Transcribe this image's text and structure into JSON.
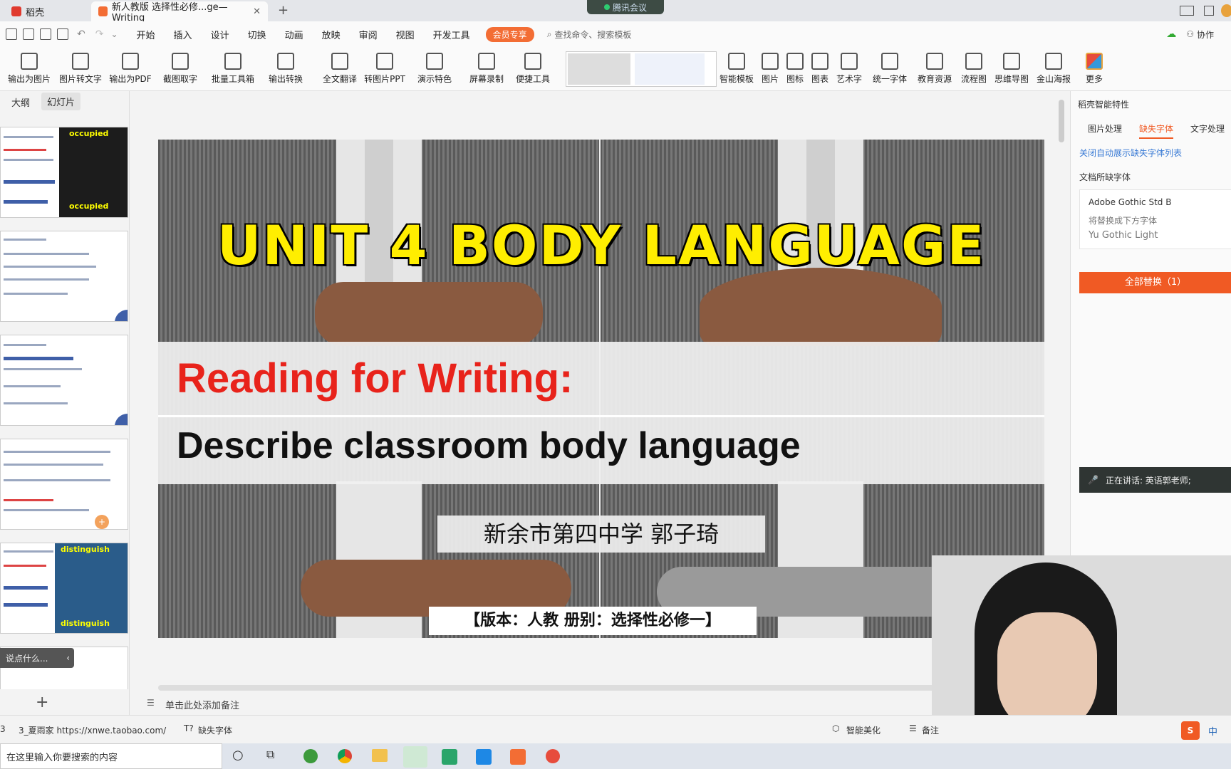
{
  "tabs": [
    {
      "label": "稻壳"
    },
    {
      "label": "新人教版 选择性必修...ge—Writing"
    }
  ],
  "meeting_badge": "腾讯会议",
  "menu": [
    "开始",
    "插入",
    "设计",
    "切换",
    "动画",
    "放映",
    "审阅",
    "视图",
    "开发工具"
  ],
  "vip_label": "会员专享",
  "search_placeholder": "查找命令、搜索模板",
  "collab_label": "协作",
  "ribbon": [
    "输出为图片",
    "图片转文字",
    "输出为PDF",
    "截图取字",
    "批量工具箱",
    "输出转换",
    "全文翻译",
    "转图片PPT",
    "演示特色",
    "屏幕录制",
    "便捷工具",
    "智能模板",
    "图片",
    "图标",
    "图表",
    "艺术字",
    "统一字体",
    "教育资源",
    "流程图",
    "思维导图",
    "金山海报",
    "更多"
  ],
  "left_tabs": {
    "outline": "大纲",
    "slides": "幻灯片"
  },
  "thumb_words": {
    "t1_top": "occupied",
    "t1_bottom": "occupied",
    "t5_top": "distinguish",
    "t5_bottom": "distinguish"
  },
  "chat_hint": "说点什么...",
  "slide": {
    "title": "UNIT 4 BODY LANGUAGE",
    "subtitle_red": "Reading for Writing:",
    "subtitle_black": "Describe classroom body language",
    "author": "新余市第四中学  郭子琦",
    "edition": "【版本：人教   册别：选择性必修一】"
  },
  "notes_placeholder": "单击此处添加备注",
  "right_panel": {
    "header": "稻壳智能特性",
    "tabs": [
      "图片处理",
      "缺失字体",
      "文字处理"
    ],
    "link": "关闭自动展示缺失字体列表",
    "section": "文档所缺字体",
    "font_name": "Adobe Gothic Std B",
    "replace_hint": "将替换成下方字体",
    "replacement": "Yu Gothic Light",
    "replace_button": "全部替换（1）",
    "speaking": "正在讲话: 英语郭老师;"
  },
  "status": {
    "num": "3",
    "source": "3_夏雨家 https://xnwe.taobao.com/",
    "missing_font": "缺失字体",
    "beautify": "智能美化",
    "notes": "备注",
    "ime": "中"
  },
  "taskbar_search": "在这里输入你要搜索的内容",
  "colors": {
    "accent": "#f36d34",
    "title_yellow": "#ffee00",
    "subtitle_red": "#e8231b",
    "button_orange": "#f05a24"
  }
}
